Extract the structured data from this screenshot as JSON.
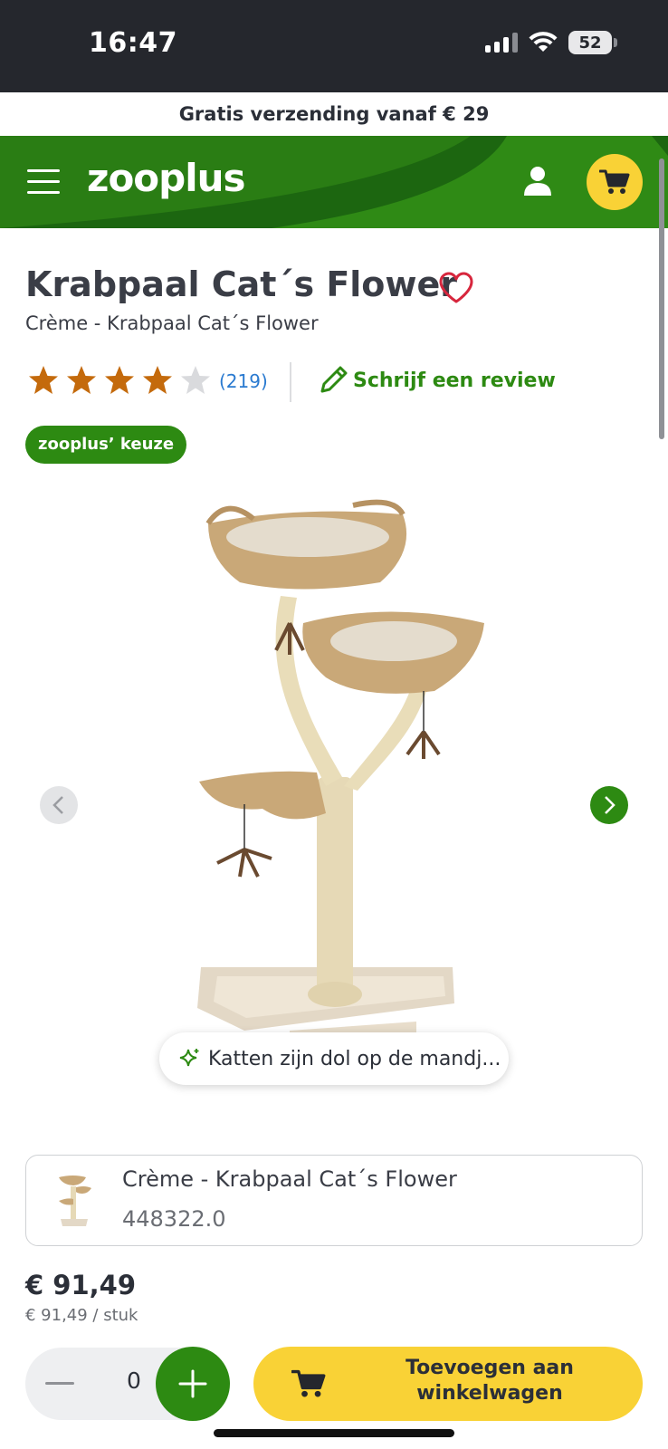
{
  "status_bar": {
    "time": "16:47",
    "battery": "52"
  },
  "shipping_banner": "Gratis verzending vanaf € 29",
  "header": {
    "logo": "zooplus"
  },
  "product": {
    "title": "Krabpaal Cat´s Flower",
    "subtitle": "Crème - Krabpaal Cat´s Flower",
    "rating_stars": 4,
    "rating_max": 5,
    "review_count": "(219)",
    "write_review_label": "Schrijf een review",
    "badge": "zooplus’ keuze",
    "ai_summary": "Katten zijn dol op de mandj..."
  },
  "variant": {
    "name": "Crème - Krabpaal Cat´s Flower",
    "sku": "448322.0"
  },
  "pricing": {
    "price": "€ 91,49",
    "unit_price": "€ 91,49 / stuk"
  },
  "cart": {
    "quantity": "0",
    "add_label": "Toevoegen aan winkelwagen"
  },
  "colors": {
    "brand_green": "#2d8a12",
    "accent_yellow": "#f9d236",
    "star_orange": "#c46a0c"
  }
}
